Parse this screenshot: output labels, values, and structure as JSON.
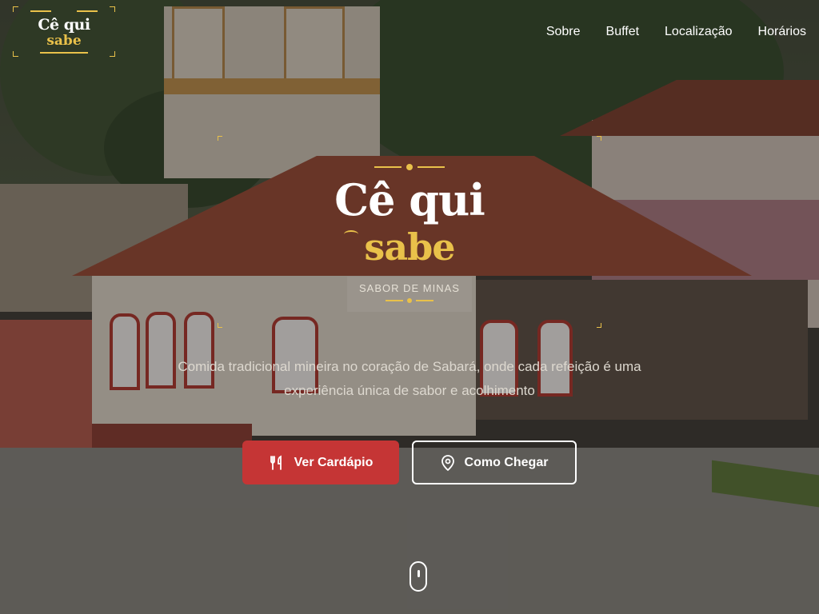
{
  "brand": {
    "line1": "Cê qui",
    "line2": "sabe"
  },
  "nav": {
    "items": [
      "Sobre",
      "Buffet",
      "Localização",
      "Horários"
    ]
  },
  "hero": {
    "title_line1": "Cê qui",
    "title_line2": "sabe",
    "subtitle": "SABOR DE MINAS",
    "tagline_line1": "Comida tradicional mineira no coração de Sabará, onde cada refeição é uma",
    "tagline_line2": "experiência única de sabor e acolhimento"
  },
  "buttons": {
    "menu": {
      "label": "Ver Cardápio",
      "icon": "utensils-icon"
    },
    "directions": {
      "label": "Como Chegar",
      "icon": "map-pin-icon"
    }
  },
  "scroll_indicator": {
    "icon": "mouse-scroll-icon"
  },
  "colors": {
    "accent_gold": "#e9c14a",
    "primary_red": "#c53535",
    "text_white": "#ffffff"
  }
}
